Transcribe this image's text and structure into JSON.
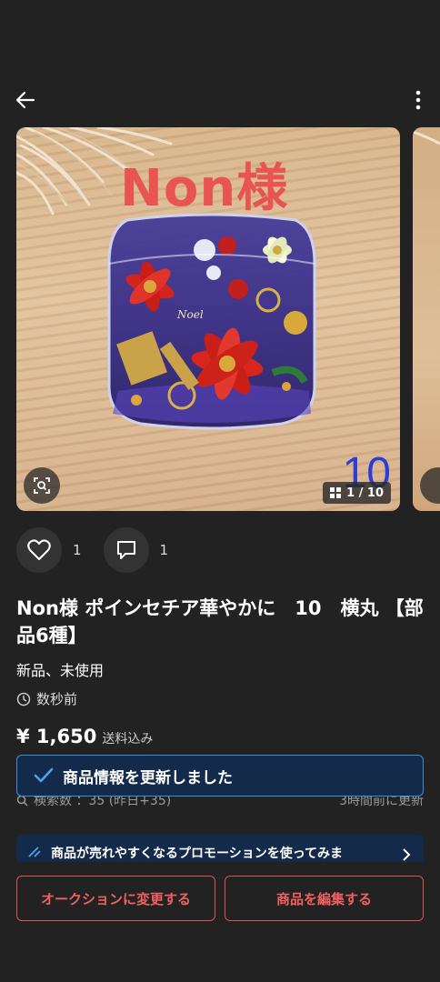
{
  "nav": {
    "back_icon": "arrow-left-icon",
    "more_icon": "more-vertical-icon"
  },
  "gallery": {
    "overlay_text": "Non様",
    "overlay_color": "#e85550",
    "big_number": "10",
    "counter": "1 / 10"
  },
  "engagement": {
    "likes": "1",
    "comments": "1"
  },
  "product": {
    "title": "Non様 ポインセチア華やかに　10　横丸 【部品6種】",
    "condition": "新品、未使用",
    "posted": "数秒前",
    "price": "¥ 1,650",
    "shipping": "送料込み"
  },
  "stats": {
    "search_count": "検索数 ：35 (昨日+35)",
    "updated": "3時間前に更新"
  },
  "toast": {
    "message": "商品情報を更新しました",
    "border_color": "#3a8ee0"
  },
  "promo": {
    "text": "商品が売れやすくなるプロモーションを使ってみま"
  },
  "buttons": {
    "auction": "オークションに変更する",
    "edit": "商品を編集する",
    "accent": "#e05252"
  }
}
